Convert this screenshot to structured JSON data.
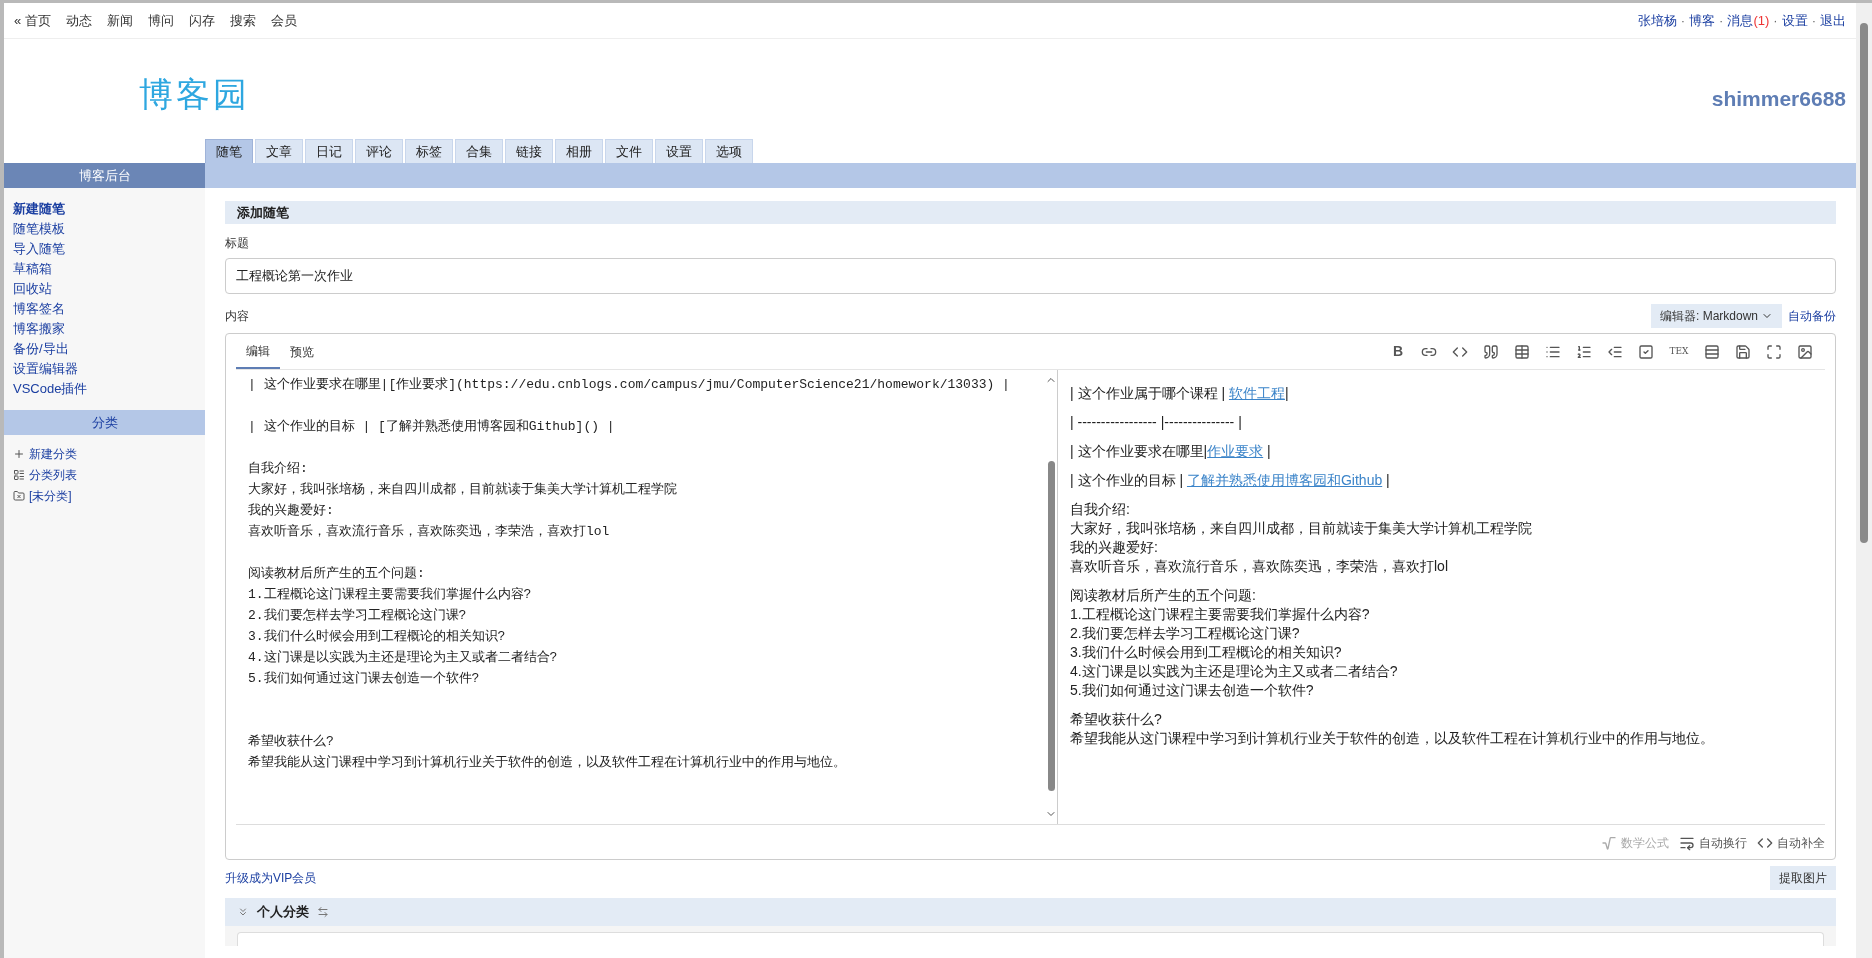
{
  "top_nav": {
    "links": [
      "« 首页",
      "动态",
      "新闻",
      "博问",
      "闪存",
      "搜索",
      "会员"
    ],
    "separator": "·",
    "user_links": [
      {
        "label": "张培杨"
      },
      {
        "label": "博客"
      },
      {
        "label": "消息",
        "badge": "(1)"
      },
      {
        "label": "设置"
      },
      {
        "label": "退出"
      }
    ]
  },
  "header": {
    "logo": "博客园",
    "username": "shimmer6688"
  },
  "tabs": [
    {
      "label": "随笔",
      "selected": true
    },
    {
      "label": "文章",
      "selected": false
    },
    {
      "label": "日记",
      "selected": false
    },
    {
      "label": "评论",
      "selected": false
    },
    {
      "label": "标签",
      "selected": false
    },
    {
      "label": "合集",
      "selected": false
    },
    {
      "label": "链接",
      "selected": false
    },
    {
      "label": "相册",
      "selected": false
    },
    {
      "label": "文件",
      "selected": false
    },
    {
      "label": "设置",
      "selected": false
    },
    {
      "label": "选项",
      "selected": false
    }
  ],
  "sidebar": {
    "title": "博客后台",
    "items": [
      {
        "label": "新建随笔",
        "selected": true
      },
      {
        "label": "随笔模板",
        "selected": false
      },
      {
        "label": "导入随笔",
        "selected": false
      },
      {
        "label": "草稿箱",
        "selected": false
      },
      {
        "label": "回收站",
        "selected": false
      },
      {
        "label": "博客签名",
        "selected": false
      },
      {
        "label": "博客搬家",
        "selected": false
      },
      {
        "label": "备份/导出",
        "selected": false
      },
      {
        "label": "设置编辑器",
        "selected": false
      },
      {
        "label": "VSCode插件",
        "selected": false
      }
    ],
    "category_title": "分类",
    "categories": [
      {
        "kind": "add",
        "label": "新建分类"
      },
      {
        "kind": "list",
        "label": "分类列表"
      },
      {
        "kind": "folder",
        "label": "[未分类]"
      }
    ]
  },
  "form": {
    "section_title": "添加随笔",
    "title_label": "标题",
    "title_value": "工程概论第一次作业",
    "content_label": "内容",
    "editor_select": "编辑器: Markdown",
    "auto_backup": "自动备份",
    "editor_tabs": [
      {
        "label": "编辑",
        "selected": true
      },
      {
        "label": "预览",
        "selected": false
      }
    ],
    "toolbar": [
      {
        "kind": "bold",
        "label": "B"
      },
      {
        "kind": "link"
      },
      {
        "kind": "code"
      },
      {
        "kind": "quote"
      },
      {
        "kind": "table"
      },
      {
        "kind": "ul"
      },
      {
        "kind": "ol"
      },
      {
        "kind": "indent"
      },
      {
        "kind": "task"
      },
      {
        "kind": "tex",
        "label": "TEX"
      },
      {
        "kind": "hr"
      },
      {
        "kind": "save"
      },
      {
        "kind": "fullscreen"
      },
      {
        "kind": "image"
      }
    ],
    "source_blocks": [
      {
        "lines": [
          "| 这个作业要求在哪里|[作业要求](https://edu.cnblogs.com/campus/jmu/ComputerScience21/homework/13033) |"
        ]
      },
      {
        "lines": [
          "| 这个作业的目标 | [了解并熟悉使用博客园和Github]() |"
        ]
      },
      {
        "lines": [
          "自我介绍:",
          "大家好，我叫张培杨，来自四川成都，目前就读于集美大学计算机工程学院",
          "我的兴趣爱好:",
          "喜欢听音乐，喜欢流行音乐，喜欢陈奕迅，李荣浩，喜欢打lol"
        ]
      },
      {
        "lines": [
          "阅读教材后所产生的五个问题:",
          "1.工程概论这门课程主要需要我们掌握什么内容?",
          "2.我们要怎样去学习工程概论这门课?",
          "3.我们什么时候会用到工程概论的相关知识?",
          "4.这门课是以实践为主还是理论为主又或者二者结合?",
          "5.我们如何通过这门课去创造一个软件?"
        ]
      },
      {
        "lines": [
          "希望收获什么?",
          "希望我能从这门课程中学习到计算机行业关于软件的创造，以及软件工程在计算机行业中的作用与地位。"
        ],
        "wide_gap": true
      }
    ],
    "preview_paragraphs": [
      {
        "lines": [
          [
            {
              "text": "| 这个作业属于哪个课程 | "
            },
            {
              "link": "软件工程"
            },
            {
              "text": "|"
            }
          ]
        ]
      },
      {
        "lines": [
          [
            {
              "text": "| ----------------- |--------------- |"
            }
          ]
        ]
      },
      {
        "lines": [
          [
            {
              "text": "| 这个作业要求在哪里|"
            },
            {
              "link": "作业要求"
            },
            {
              "text": " |"
            }
          ]
        ]
      },
      {
        "lines": [
          [
            {
              "text": "| 这个作业的目标 | "
            },
            {
              "link": "了解并熟悉使用博客园和Github"
            },
            {
              "text": " |"
            }
          ]
        ]
      },
      {
        "lines": [
          [
            {
              "text": "自我介绍:"
            }
          ],
          [
            {
              "text": "大家好，我叫张培杨，来自四川成都，目前就读于集美大学计算机工程学院"
            }
          ],
          [
            {
              "text": "我的兴趣爱好:"
            }
          ],
          [
            {
              "text": "喜欢听音乐，喜欢流行音乐，喜欢陈奕迅，李荣浩，喜欢打lol"
            }
          ]
        ]
      },
      {
        "lines": [
          [
            {
              "text": "阅读教材后所产生的五个问题:"
            }
          ],
          [
            {
              "text": "1.工程概论这门课程主要需要我们掌握什么内容?"
            }
          ],
          [
            {
              "text": "2.我们要怎样去学习工程概论这门课?"
            }
          ],
          [
            {
              "text": "3.我们什么时候会用到工程概论的相关知识?"
            }
          ],
          [
            {
              "text": "4.这门课是以实践为主还是理论为主又或者二者结合?"
            }
          ],
          [
            {
              "text": "5.我们如何通过这门课去创造一个软件?"
            }
          ]
        ]
      },
      {
        "lines": [
          [
            {
              "text": "希望收获什么?"
            }
          ],
          [
            {
              "text": "希望我能从这门课程中学习到计算机行业关于软件的创造，以及软件工程在计算机行业中的作用与地位。"
            }
          ]
        ]
      }
    ],
    "status": [
      {
        "kind": "math",
        "label": "数学公式",
        "on": false
      },
      {
        "kind": "wrap",
        "label": "自动换行",
        "on": true
      },
      {
        "kind": "complete",
        "label": "自动补全",
        "on": true
      }
    ],
    "vip_link": "升级成为VIP会员",
    "extract_button": "提取图片",
    "category_section": "个人分类"
  }
}
